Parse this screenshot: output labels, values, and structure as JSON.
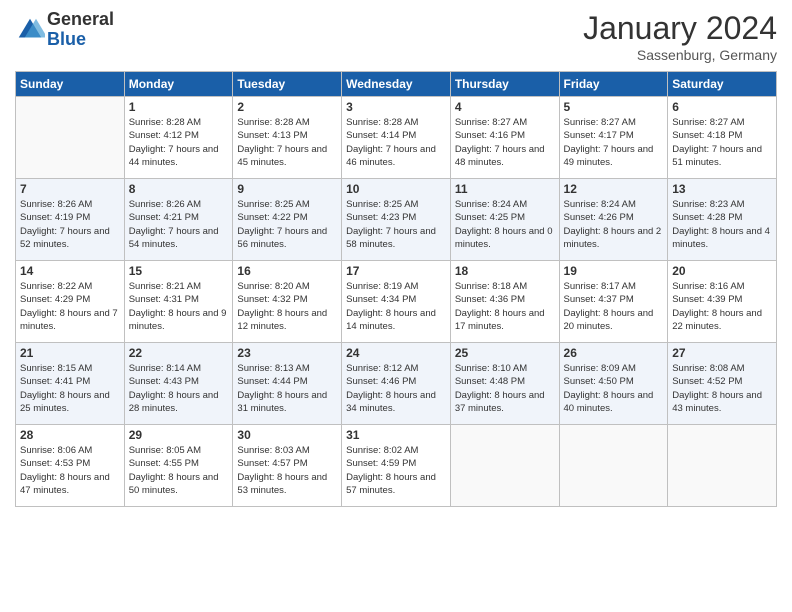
{
  "logo": {
    "text_general": "General",
    "text_blue": "Blue"
  },
  "title": "January 2024",
  "subtitle": "Sassenburg, Germany",
  "days_header": [
    "Sunday",
    "Monday",
    "Tuesday",
    "Wednesday",
    "Thursday",
    "Friday",
    "Saturday"
  ],
  "weeks": [
    [
      {
        "day": "",
        "sunrise": "",
        "sunset": "",
        "daylight": ""
      },
      {
        "day": "1",
        "sunrise": "Sunrise: 8:28 AM",
        "sunset": "Sunset: 4:12 PM",
        "daylight": "Daylight: 7 hours and 44 minutes."
      },
      {
        "day": "2",
        "sunrise": "Sunrise: 8:28 AM",
        "sunset": "Sunset: 4:13 PM",
        "daylight": "Daylight: 7 hours and 45 minutes."
      },
      {
        "day": "3",
        "sunrise": "Sunrise: 8:28 AM",
        "sunset": "Sunset: 4:14 PM",
        "daylight": "Daylight: 7 hours and 46 minutes."
      },
      {
        "day": "4",
        "sunrise": "Sunrise: 8:27 AM",
        "sunset": "Sunset: 4:16 PM",
        "daylight": "Daylight: 7 hours and 48 minutes."
      },
      {
        "day": "5",
        "sunrise": "Sunrise: 8:27 AM",
        "sunset": "Sunset: 4:17 PM",
        "daylight": "Daylight: 7 hours and 49 minutes."
      },
      {
        "day": "6",
        "sunrise": "Sunrise: 8:27 AM",
        "sunset": "Sunset: 4:18 PM",
        "daylight": "Daylight: 7 hours and 51 minutes."
      }
    ],
    [
      {
        "day": "7",
        "sunrise": "Sunrise: 8:26 AM",
        "sunset": "Sunset: 4:19 PM",
        "daylight": "Daylight: 7 hours and 52 minutes."
      },
      {
        "day": "8",
        "sunrise": "Sunrise: 8:26 AM",
        "sunset": "Sunset: 4:21 PM",
        "daylight": "Daylight: 7 hours and 54 minutes."
      },
      {
        "day": "9",
        "sunrise": "Sunrise: 8:25 AM",
        "sunset": "Sunset: 4:22 PM",
        "daylight": "Daylight: 7 hours and 56 minutes."
      },
      {
        "day": "10",
        "sunrise": "Sunrise: 8:25 AM",
        "sunset": "Sunset: 4:23 PM",
        "daylight": "Daylight: 7 hours and 58 minutes."
      },
      {
        "day": "11",
        "sunrise": "Sunrise: 8:24 AM",
        "sunset": "Sunset: 4:25 PM",
        "daylight": "Daylight: 8 hours and 0 minutes."
      },
      {
        "day": "12",
        "sunrise": "Sunrise: 8:24 AM",
        "sunset": "Sunset: 4:26 PM",
        "daylight": "Daylight: 8 hours and 2 minutes."
      },
      {
        "day": "13",
        "sunrise": "Sunrise: 8:23 AM",
        "sunset": "Sunset: 4:28 PM",
        "daylight": "Daylight: 8 hours and 4 minutes."
      }
    ],
    [
      {
        "day": "14",
        "sunrise": "Sunrise: 8:22 AM",
        "sunset": "Sunset: 4:29 PM",
        "daylight": "Daylight: 8 hours and 7 minutes."
      },
      {
        "day": "15",
        "sunrise": "Sunrise: 8:21 AM",
        "sunset": "Sunset: 4:31 PM",
        "daylight": "Daylight: 8 hours and 9 minutes."
      },
      {
        "day": "16",
        "sunrise": "Sunrise: 8:20 AM",
        "sunset": "Sunset: 4:32 PM",
        "daylight": "Daylight: 8 hours and 12 minutes."
      },
      {
        "day": "17",
        "sunrise": "Sunrise: 8:19 AM",
        "sunset": "Sunset: 4:34 PM",
        "daylight": "Daylight: 8 hours and 14 minutes."
      },
      {
        "day": "18",
        "sunrise": "Sunrise: 8:18 AM",
        "sunset": "Sunset: 4:36 PM",
        "daylight": "Daylight: 8 hours and 17 minutes."
      },
      {
        "day": "19",
        "sunrise": "Sunrise: 8:17 AM",
        "sunset": "Sunset: 4:37 PM",
        "daylight": "Daylight: 8 hours and 20 minutes."
      },
      {
        "day": "20",
        "sunrise": "Sunrise: 8:16 AM",
        "sunset": "Sunset: 4:39 PM",
        "daylight": "Daylight: 8 hours and 22 minutes."
      }
    ],
    [
      {
        "day": "21",
        "sunrise": "Sunrise: 8:15 AM",
        "sunset": "Sunset: 4:41 PM",
        "daylight": "Daylight: 8 hours and 25 minutes."
      },
      {
        "day": "22",
        "sunrise": "Sunrise: 8:14 AM",
        "sunset": "Sunset: 4:43 PM",
        "daylight": "Daylight: 8 hours and 28 minutes."
      },
      {
        "day": "23",
        "sunrise": "Sunrise: 8:13 AM",
        "sunset": "Sunset: 4:44 PM",
        "daylight": "Daylight: 8 hours and 31 minutes."
      },
      {
        "day": "24",
        "sunrise": "Sunrise: 8:12 AM",
        "sunset": "Sunset: 4:46 PM",
        "daylight": "Daylight: 8 hours and 34 minutes."
      },
      {
        "day": "25",
        "sunrise": "Sunrise: 8:10 AM",
        "sunset": "Sunset: 4:48 PM",
        "daylight": "Daylight: 8 hours and 37 minutes."
      },
      {
        "day": "26",
        "sunrise": "Sunrise: 8:09 AM",
        "sunset": "Sunset: 4:50 PM",
        "daylight": "Daylight: 8 hours and 40 minutes."
      },
      {
        "day": "27",
        "sunrise": "Sunrise: 8:08 AM",
        "sunset": "Sunset: 4:52 PM",
        "daylight": "Daylight: 8 hours and 43 minutes."
      }
    ],
    [
      {
        "day": "28",
        "sunrise": "Sunrise: 8:06 AM",
        "sunset": "Sunset: 4:53 PM",
        "daylight": "Daylight: 8 hours and 47 minutes."
      },
      {
        "day": "29",
        "sunrise": "Sunrise: 8:05 AM",
        "sunset": "Sunset: 4:55 PM",
        "daylight": "Daylight: 8 hours and 50 minutes."
      },
      {
        "day": "30",
        "sunrise": "Sunrise: 8:03 AM",
        "sunset": "Sunset: 4:57 PM",
        "daylight": "Daylight: 8 hours and 53 minutes."
      },
      {
        "day": "31",
        "sunrise": "Sunrise: 8:02 AM",
        "sunset": "Sunset: 4:59 PM",
        "daylight": "Daylight: 8 hours and 57 minutes."
      },
      {
        "day": "",
        "sunrise": "",
        "sunset": "",
        "daylight": ""
      },
      {
        "day": "",
        "sunrise": "",
        "sunset": "",
        "daylight": ""
      },
      {
        "day": "",
        "sunrise": "",
        "sunset": "",
        "daylight": ""
      }
    ]
  ]
}
